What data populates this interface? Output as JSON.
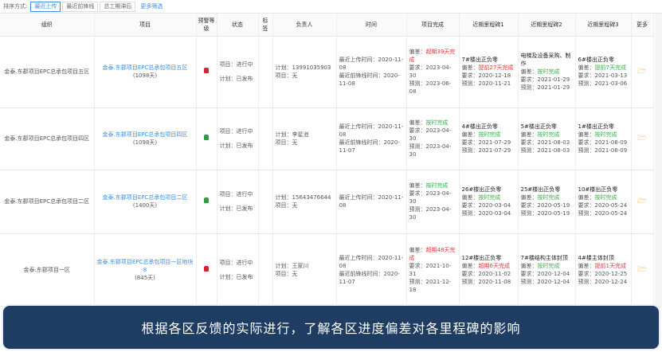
{
  "sort_bar": {
    "label": "排序方式:",
    "options": [
      "最近上传",
      "最近前锋线",
      "总工期滞后"
    ],
    "more_filter": "更多筛选"
  },
  "table": {
    "headers": [
      "组织",
      "项目",
      "预警等级",
      "状态",
      "标签",
      "负责人",
      "时间",
      "项目完成",
      "近期里程碑1",
      "近期里程碑2",
      "近期里程碑3",
      "更多"
    ],
    "rows": [
      {
        "org": "金泰.东郡项目EPC总承包项目五区",
        "project": "金泰.东郡项目EPC总承包项目五区",
        "days": "(1098天)",
        "warning": "red",
        "status1": "项目：进行中",
        "status2": "计划：已发布",
        "manager1": "计划：13991035903",
        "manager2": "项目：无",
        "time1": "最近上传时间：2020-11-08",
        "time2": "最近前锋线时间：2020-11-08",
        "completion": {
          "label": "偏差：",
          "value": "超期39天完成",
          "color": "red",
          "req": "要求：2023-04-30",
          "pred": "预测：2023-06-08"
        },
        "ms1": {
          "title": "7#楼出正负零",
          "label": "偏差：",
          "value": "提前27天完成",
          "color": "red",
          "req": "要求：2020-12-18",
          "pred": "预测：2020-11-21"
        },
        "ms2": {
          "title": "电梯及设备采购、制作",
          "label": "偏差：",
          "value": "按时完成",
          "color": "green",
          "req": "要求：2021-01-29",
          "pred": "预测：2021-01-29"
        },
        "ms3": {
          "title": "6#楼出正负零",
          "label": "偏差：",
          "value": "提前7天完成",
          "color": "green",
          "req": "要求：2021-03-13",
          "pred": "预测：2021-03-06"
        }
      },
      {
        "org": "金泰.东郡项目EPC总承包项目四区",
        "project": "金泰.东郡项目EPC总承包项目四区",
        "days": "(1098天)",
        "warning": "green",
        "status1": "项目：进行中",
        "status2": "计划：已发布",
        "manager1": "计划：李星池",
        "manager2": "项目：无",
        "time1": "最近上传时间：2020-11-08",
        "time2": "最近前锋线时间：2020-11-07",
        "completion": {
          "label": "偏差：",
          "value": "按时完成",
          "color": "green",
          "req": "要求：2023-04-30",
          "pred": "预测：2023-04-30"
        },
        "ms1": {
          "title": "4#楼出正负零",
          "label": "偏差：",
          "value": "按时完成",
          "color": "green",
          "req": "要求：2021-07-29",
          "pred": "预测：2021-07-29"
        },
        "ms2": {
          "title": "5#楼出正负零",
          "label": "偏差：",
          "value": "按时完成",
          "color": "green",
          "req": "要求：2021-08-03",
          "pred": "预测：2021-08-03"
        },
        "ms3": {
          "title": "1#楼出正负零",
          "label": "偏差：",
          "value": "按时完成",
          "color": "green",
          "req": "要求：2021-08-09",
          "pred": "预测：2021-08-09"
        }
      },
      {
        "org": "金泰.东郡项目EPC总承包项目二区",
        "project": "金泰.东郡项目EPC总承包项目二区",
        "days": "(1400天)",
        "warning": "green",
        "status1": "项目：进行中",
        "status2": "计划：已发布",
        "manager1": "计划：15643476644",
        "manager2": "项目：无",
        "time1": "最近上传时间：2020-11-08",
        "time2": "",
        "completion": {
          "label": "偏差：",
          "value": "按时完成",
          "color": "green",
          "req": "要求：2023-04-30",
          "pred": "预测：2023-04-30"
        },
        "ms1": {
          "title": "26#楼出正负零",
          "label": "偏差：",
          "value": "按时完成",
          "color": "green",
          "req": "要求：2020-03-04",
          "pred": "预测：2020-03-04"
        },
        "ms2": {
          "title": "25#楼出正负零",
          "label": "偏差：",
          "value": "按时完成",
          "color": "green",
          "req": "要求：2020-05-19",
          "pred": "预测：2020-05-19"
        },
        "ms3": {
          "title": "10#楼出正负零",
          "label": "偏差：",
          "value": "按时完成",
          "color": "green",
          "req": "要求：2020-05-24",
          "pred": "预测：2020-05-24"
        }
      },
      {
        "org": "金泰.东郡项目一区",
        "project": "金泰.东郡项目EPC总承包项目一区地块8",
        "days": "(845天)",
        "warning": "red",
        "status1": "项目：进行中",
        "status2": "计划：已发布",
        "manager1": "计划：王家川",
        "manager2": "项目：无",
        "time1": "最近上传时间：2020-11-08",
        "time2": "最近前锋线时间：2020-11-07",
        "completion": {
          "label": "偏差：",
          "value": "超期48天完成",
          "color": "red",
          "req": "要求：2021-10-31",
          "pred": "预测：2021-12-18"
        },
        "ms1": {
          "title": "12#楼出正负零",
          "label": "偏差：",
          "value": "超期6天完成",
          "color": "red",
          "req": "要求：2020-11-02",
          "pred": "预测：2020-11-08"
        },
        "ms2": {
          "title": "7#楼结构主体封顶",
          "label": "偏差：",
          "value": "按时完成",
          "color": "green",
          "req": "要求：2020-12-04",
          "pred": "预测：2020-12-04"
        },
        "ms3": {
          "title": "4#楼主体封顶",
          "label": "偏差：",
          "value": "提前1天完成",
          "color": "red",
          "req": "要求：2020-12-25",
          "pred": "预测：2020-12-24"
        }
      }
    ]
  },
  "banner": {
    "text": "根据各区反馈的实际进行，了解各区进度偏差对各里程碑的影响"
  }
}
